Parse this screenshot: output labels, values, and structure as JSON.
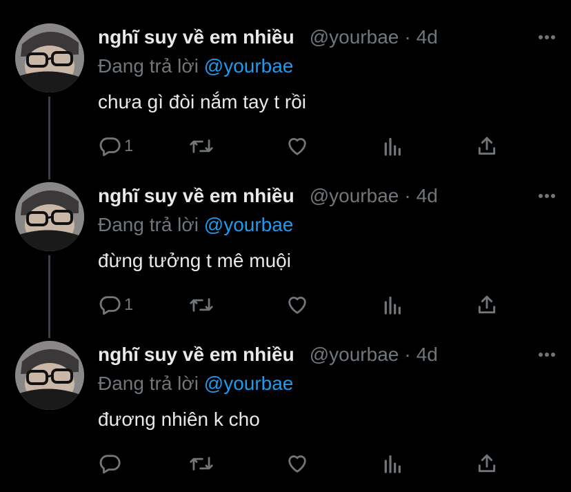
{
  "tweets": [
    {
      "author_name": "nghĩ suy về em nhiều",
      "handle": "@yourbae",
      "separator": "·",
      "time": "4d",
      "replying_prefix": "Đang trả lời",
      "replying_mention": "@yourbae",
      "text": "chưa gì đòi nắm tay t rồi",
      "reply_count": "1"
    },
    {
      "author_name": "nghĩ suy về em nhiều",
      "handle": "@yourbae",
      "separator": "·",
      "time": "4d",
      "replying_prefix": "Đang trả lời",
      "replying_mention": "@yourbae",
      "text": "đừng tưởng t mê muội",
      "reply_count": "1"
    },
    {
      "author_name": "nghĩ suy về em nhiều",
      "handle": "@yourbae",
      "separator": "·",
      "time": "4d",
      "replying_prefix": "Đang trả lời",
      "replying_mention": "@yourbae",
      "text": "đương nhiên k cho",
      "reply_count": ""
    }
  ],
  "icons": {
    "more": "more-dots-icon",
    "reply": "reply-bubble-icon",
    "retweet": "retweet-icon",
    "like": "heart-icon",
    "views": "views-chart-icon",
    "share": "share-upload-icon"
  },
  "colors": {
    "background": "#000000",
    "text_primary": "#e7e9ea",
    "text_secondary": "#71767b",
    "link": "#1d9bf0",
    "thread_line": "#3b4047"
  }
}
